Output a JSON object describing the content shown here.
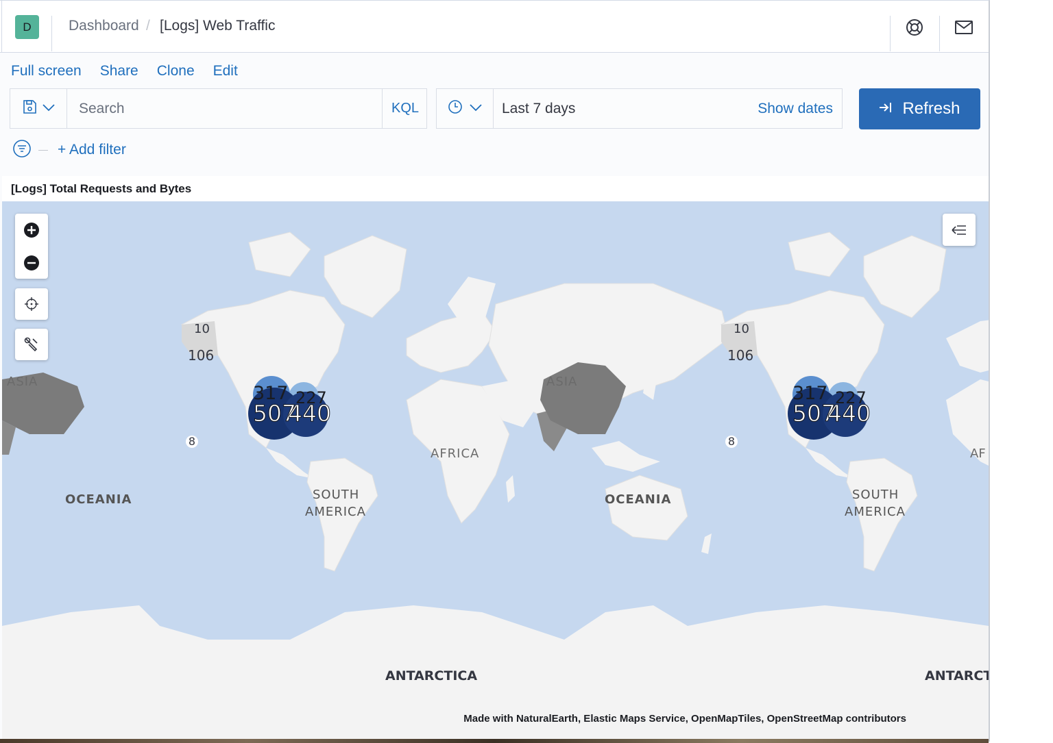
{
  "header": {
    "avatar_initial": "D",
    "breadcrumb_root": "Dashboard",
    "breadcrumb_sep": "/",
    "breadcrumb_current": "[Logs] Web Traffic",
    "help_icon": "help-ring-icon",
    "news_icon": "mail-icon"
  },
  "topnav": {
    "full_screen": "Full screen",
    "share": "Share",
    "clone": "Clone",
    "edit": "Edit"
  },
  "query": {
    "saved_query_icon": "save-icon",
    "search_placeholder": "Search",
    "search_value": "",
    "language": "KQL"
  },
  "time": {
    "quick_menu_icon": "clock-icon",
    "range_label": "Last 7 days",
    "show_dates": "Show dates"
  },
  "refresh": {
    "label": "Refresh",
    "icon": "refresh-arrow-icon"
  },
  "filters": {
    "add_filter": "+ Add filter",
    "filter_icon": "filter-icon"
  },
  "panel": {
    "title": "[Logs] Total Requests and Bytes",
    "map": {
      "colors": {
        "ocean": "#c6d8ef",
        "land": "#f3f3f3",
        "highlight": "#7b7b7b"
      },
      "labels": [
        "ASIA",
        "AFRICA",
        "OCEANIA",
        "SOUTH",
        "AMERICA",
        "ANTARCTICA",
        "AF",
        "ANTARCT"
      ],
      "clusters": [
        {
          "top": "317",
          "bottom": "507"
        },
        {
          "top": "227",
          "bottom": "440"
        }
      ],
      "small_markers": [
        "10",
        "106",
        "8"
      ],
      "attribution": "Made with NaturalEarth, Elastic Maps Service, OpenMapTiles, OpenStreetMap contributors"
    },
    "map_controls": {
      "zoom_in": "plus-circle-icon",
      "zoom_out": "minus-circle-icon",
      "fit_bounds": "crosshair-icon",
      "tools": "tools-icon",
      "legend_toggle": "collapse-left-icon"
    }
  }
}
